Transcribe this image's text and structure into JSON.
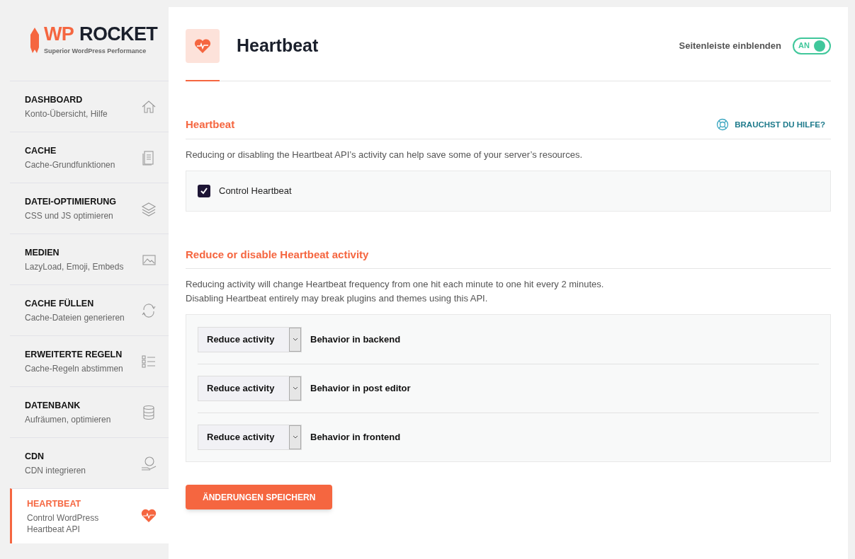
{
  "logo": {
    "mark": "WP",
    "name": "ROCKET",
    "tagline": "Superior WordPress Performance"
  },
  "sidebar": {
    "items": [
      {
        "title": "DASHBOARD",
        "subtitle": "Konto-Übersicht, Hilfe",
        "kind": "home",
        "selected": false
      },
      {
        "title": "CACHE",
        "subtitle": "Cache-Grundfunktionen",
        "kind": "document",
        "selected": false
      },
      {
        "title": "DATEI-OPTIMIERUNG",
        "subtitle": "CSS und JS optimieren",
        "kind": "layers",
        "selected": false
      },
      {
        "title": "MEDIEN",
        "subtitle": "LazyLoad, Emoji, Embeds",
        "kind": "images",
        "selected": false
      },
      {
        "title": "CACHE FÜLLEN",
        "subtitle": "Cache-Dateien generieren",
        "kind": "refresh",
        "selected": false
      },
      {
        "title": "ERWEITERTE REGELN",
        "subtitle": "Cache-Regeln abstimmen",
        "kind": "checklist",
        "selected": false
      },
      {
        "title": "DATENBANK",
        "subtitle": "Aufräumen, optimieren",
        "kind": "database",
        "selected": false
      },
      {
        "title": "CDN",
        "subtitle": "CDN integrieren",
        "kind": "globe",
        "selected": false
      },
      {
        "title": "HEARTBEAT",
        "subtitle": "Control WordPress Heartbeat API",
        "kind": "heart",
        "selected": true
      }
    ]
  },
  "header": {
    "title": "Heartbeat",
    "sidebar_toggle": {
      "label": "Seitenleiste einblenden",
      "value": "AN",
      "on": true
    }
  },
  "sections": [
    {
      "title": "Heartbeat",
      "help_link": "BRAUCHST DU HILFE?",
      "description": [
        "Reducing or disabling the Heartbeat API’s activity can help save some of your server’s resources."
      ],
      "fields": [
        {
          "kind": "checkbox",
          "label": "Control Heartbeat",
          "checked": true
        }
      ]
    },
    {
      "title": "Reduce or disable Heartbeat activity",
      "description": [
        "Reducing activity will change Heartbeat frequency from one hit each minute to one hit every 2 minutes.",
        "Disabling Heartbeat entirely may break plugins and themes using this API."
      ],
      "fields": [
        {
          "kind": "select",
          "value": "Reduce activity",
          "label": "Behavior in backend"
        },
        {
          "kind": "select",
          "value": "Reduce activity",
          "label": "Behavior in post editor"
        },
        {
          "kind": "select",
          "value": "Reduce activity",
          "label": "Behavior in frontend"
        }
      ]
    }
  ],
  "save_button": "ÄNDERUNGEN SPEICHERN"
}
